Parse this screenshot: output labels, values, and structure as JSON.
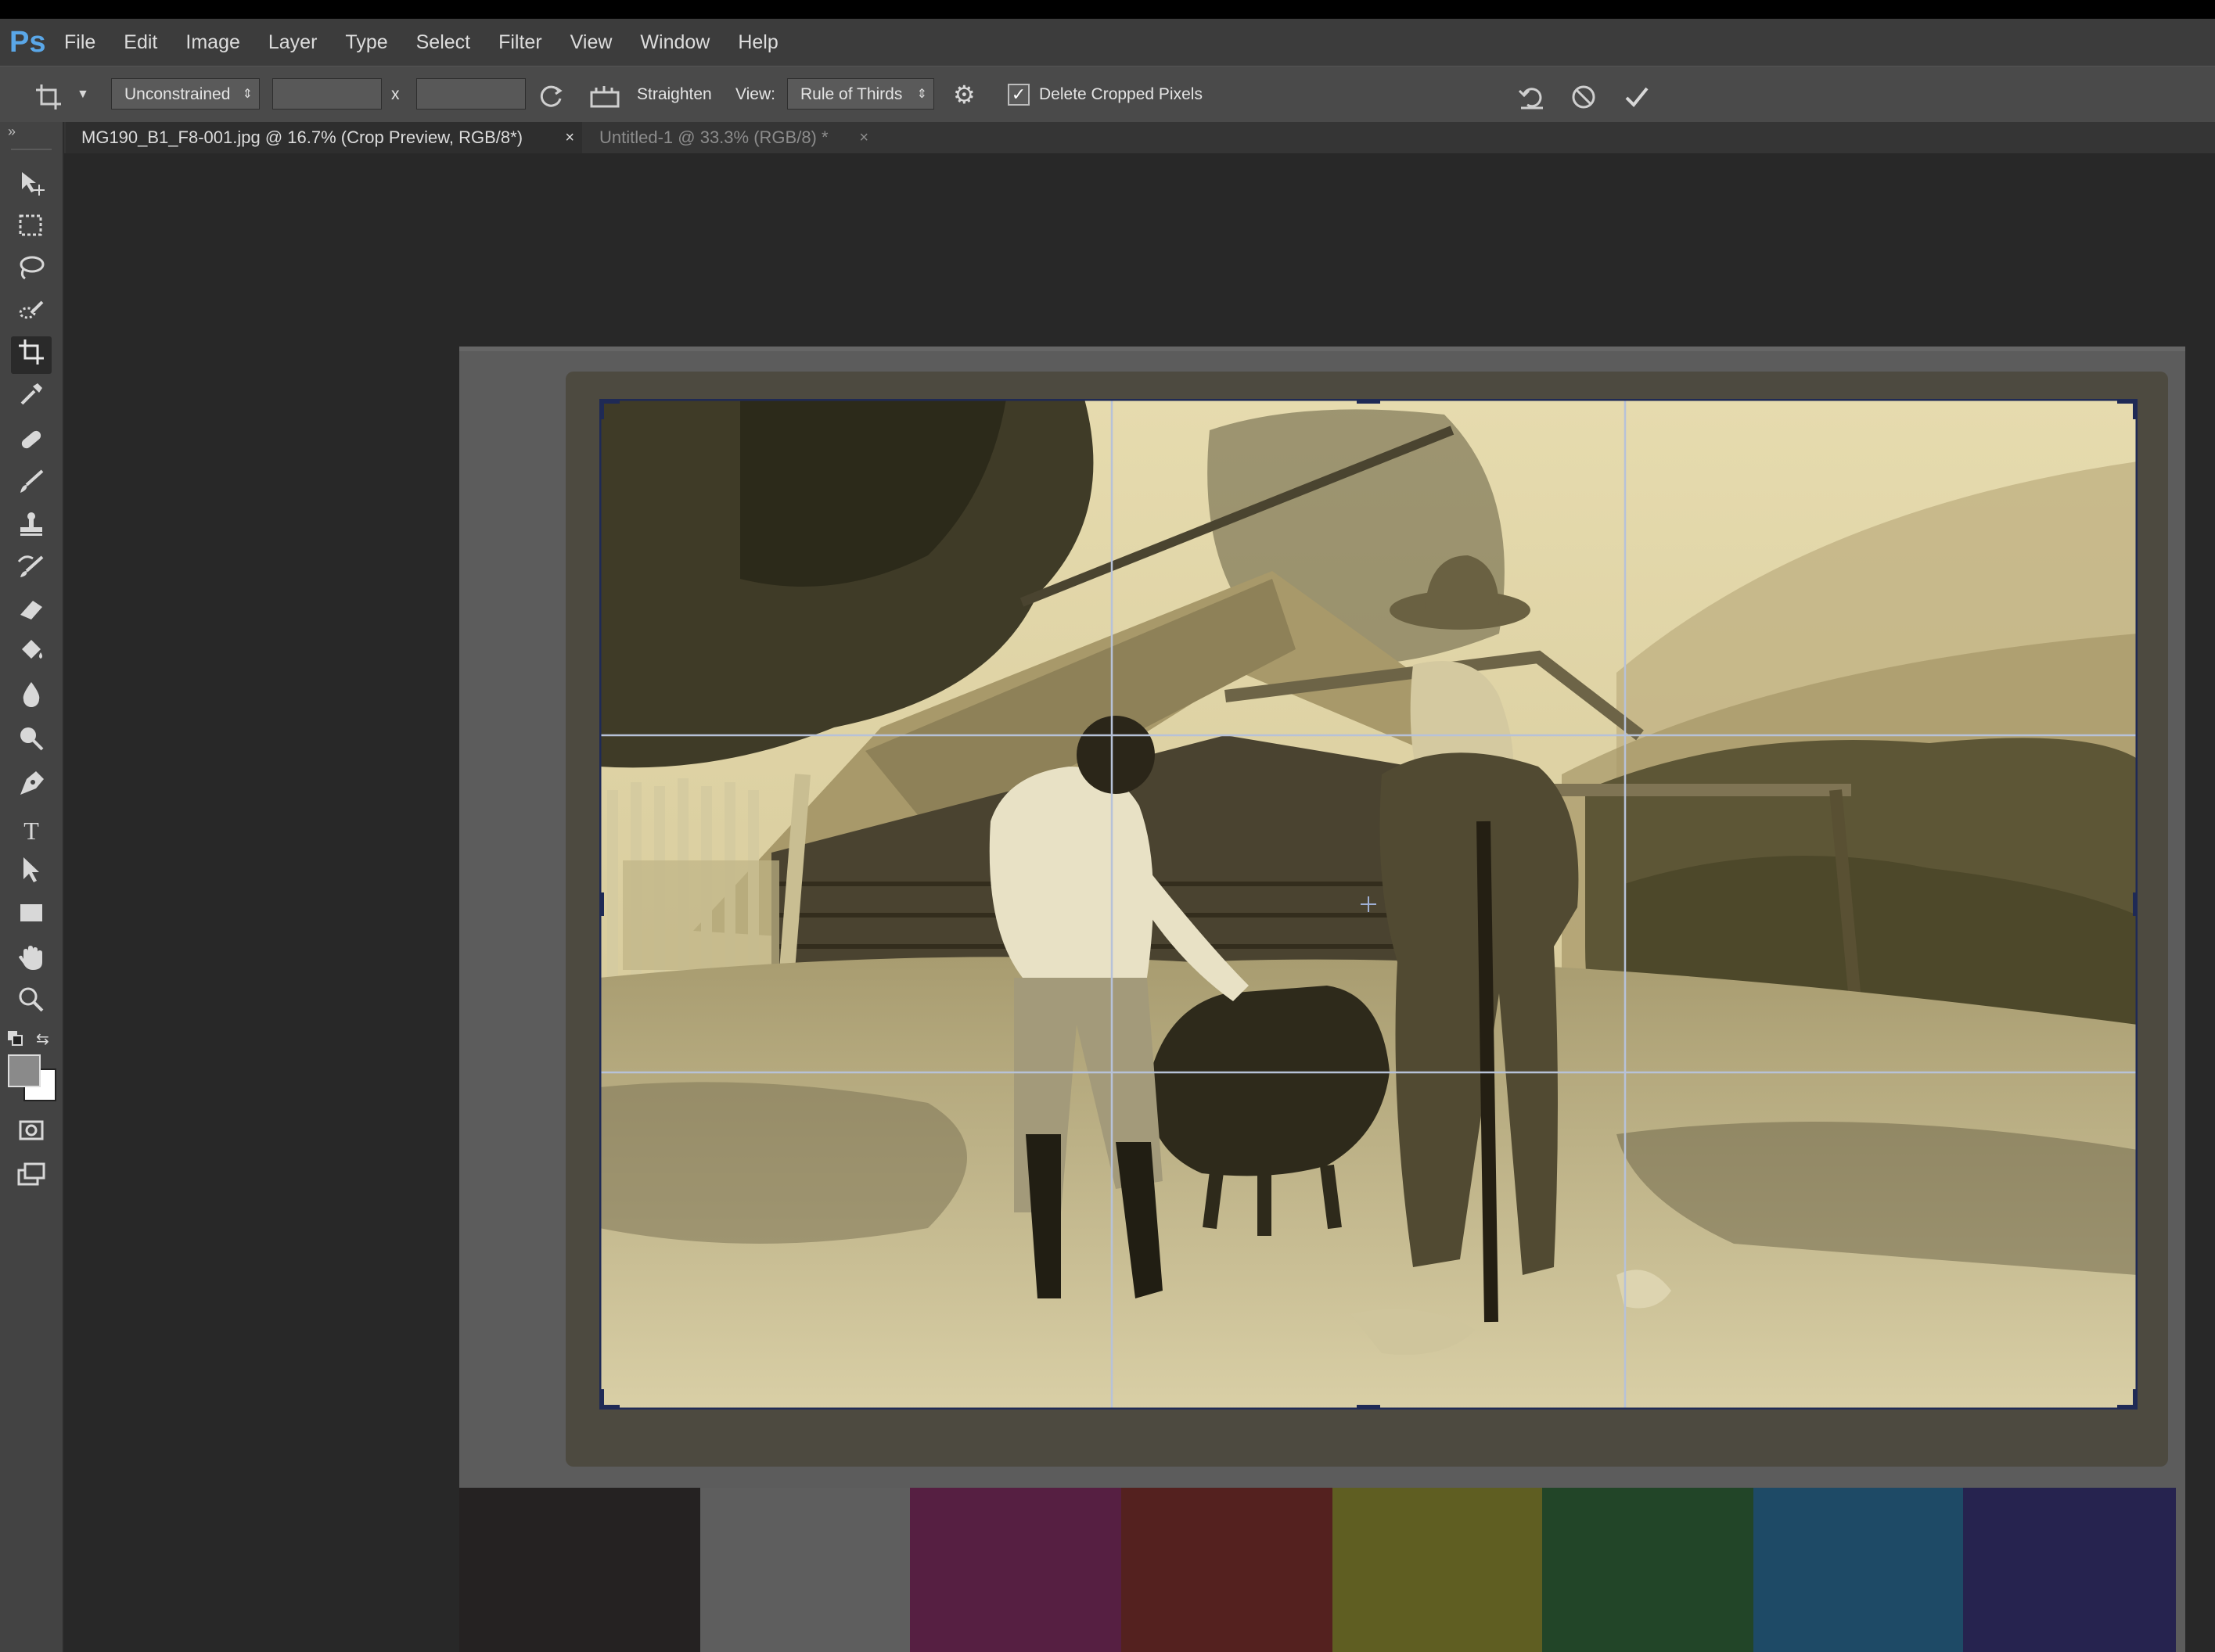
{
  "app": {
    "logo": "Ps"
  },
  "menu": [
    "File",
    "Edit",
    "Image",
    "Layer",
    "Type",
    "Select",
    "Filter",
    "View",
    "Window",
    "Help"
  ],
  "options_bar": {
    "tool_icon": "crop-icon",
    "ratio_select": "Unconstrained",
    "width_value": "",
    "height_value": "",
    "times_symbol": "x",
    "straighten_label": "Straighten",
    "view_label": "View:",
    "view_select": "Rule of Thirds",
    "delete_cropped_label": "Delete Cropped Pixels",
    "delete_cropped_checked": true
  },
  "tabs": [
    {
      "label": "MG190_B1_F8-001.jpg @ 16.7% (Crop Preview, RGB/8*)",
      "active": true
    },
    {
      "label": "Untitled-1 @ 33.3% (RGB/8) *",
      "active": false
    }
  ],
  "tools": [
    "move-tool-icon",
    "marquee-tool-icon",
    "lasso-tool-icon",
    "quick-selection-tool-icon",
    "crop-tool-icon",
    "eyedropper-tool-icon",
    "healing-brush-tool-icon",
    "brush-tool-icon",
    "clone-stamp-tool-icon",
    "history-brush-tool-icon",
    "eraser-tool-icon",
    "paint-bucket-tool-icon",
    "blur-tool-icon",
    "dodge-tool-icon",
    "pen-tool-icon",
    "type-tool-icon",
    "path-selection-tool-icon",
    "rectangle-tool-icon",
    "hand-tool-icon",
    "zoom-tool-icon"
  ],
  "type_tool_glyph": "T",
  "colors": {
    "foreground": "#8a8a8a",
    "background": "#ffffff",
    "swatches": [
      "#252222",
      "#5e5e5e",
      "#561f42",
      "#54211f",
      "#5f5e22",
      "#224528",
      "#1e4a66",
      "#26234f"
    ]
  }
}
